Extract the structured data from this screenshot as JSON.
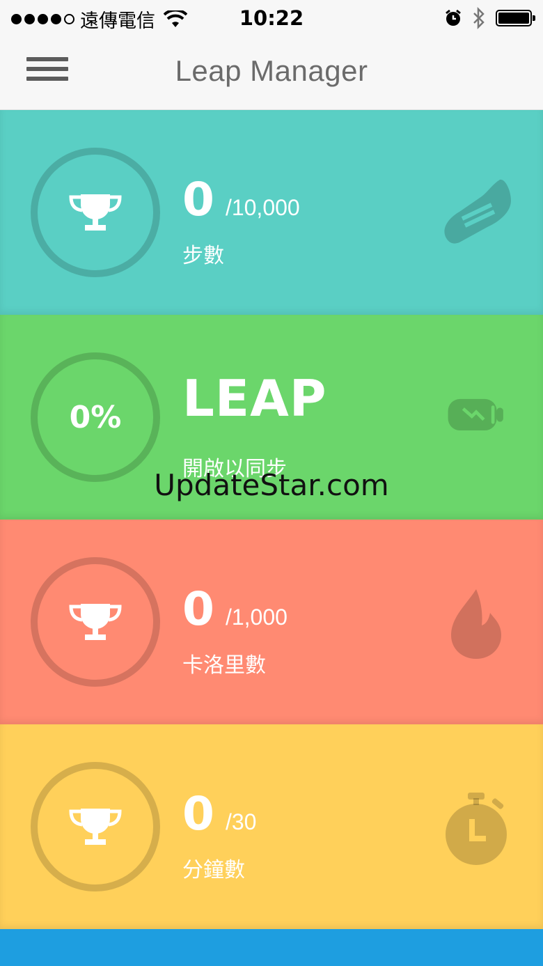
{
  "status_bar": {
    "carrier": "遠傳電信",
    "time": "10:22"
  },
  "nav": {
    "title": "Leap Manager",
    "menu_icon": "hamburger-menu-icon"
  },
  "cards": [
    {
      "color": "#5acfc4",
      "ring_icon": "trophy-icon",
      "value": "0",
      "goal": "/10,000",
      "label": "步數",
      "icon": "sneaker-icon"
    },
    {
      "color": "#6bd66b",
      "ring_text": "0%",
      "title": "LEAP",
      "subtitle": "開啟以同步",
      "icon": "battery-charging-icon"
    },
    {
      "color": "#ff8a72",
      "ring_icon": "trophy-icon",
      "value": "0",
      "goal": "/1,000",
      "label": "卡洛里數",
      "icon": "flame-icon"
    },
    {
      "color": "#ffd05a",
      "ring_icon": "trophy-icon",
      "value": "0",
      "goal": "/30",
      "label": "分鐘數",
      "icon": "stopwatch-icon"
    }
  ],
  "bottom_strip_color": "#1e9ee0",
  "watermark": "UpdateStar.com"
}
